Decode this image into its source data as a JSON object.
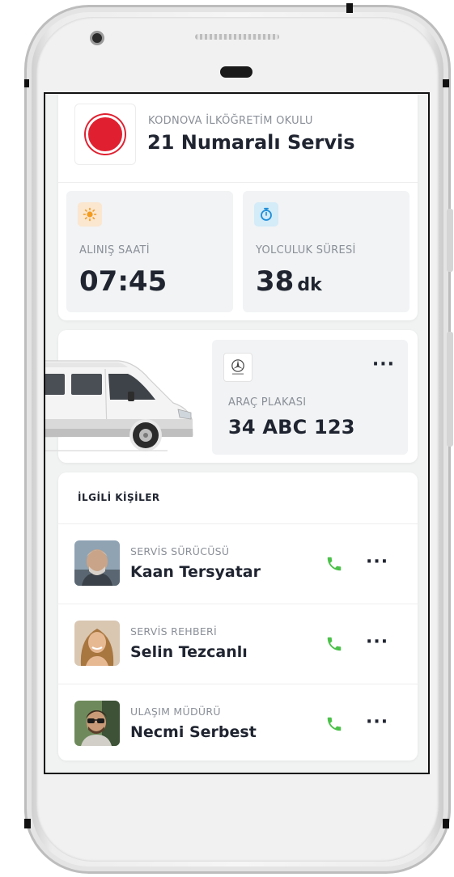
{
  "school": {
    "name": "KODNOVA İLKÖĞRETİM OKULU",
    "bus_title": "21 Numaralı Servis",
    "logo_color": "#e02030"
  },
  "stats": {
    "pickup": {
      "label": "ALINIŞ SAATİ",
      "value": "07:45",
      "icon": "sun-icon"
    },
    "duration": {
      "label": "YOLCULUK SÜRESİ",
      "value": "38",
      "unit": "dk",
      "icon": "timer-icon"
    }
  },
  "vehicle": {
    "brand_icon": "mercedes-benz-logo",
    "plate_label": "ARAÇ PLAKASI",
    "plate": "34 ABC 123",
    "more": "···"
  },
  "people": {
    "title": "İLGİLİ KİŞİLER",
    "items": [
      {
        "role": "SERVİS SÜRÜCÜSÜ",
        "name": "Kaan Tersyatar",
        "more": "···"
      },
      {
        "role": "SERVİS REHBERİ",
        "name": "Selin Tezcanlı",
        "more": "···"
      },
      {
        "role": "ULAŞIM MÜDÜRÜ",
        "name": "Necmi Serbest",
        "more": "···"
      }
    ],
    "call_color": "#4cc14a"
  }
}
